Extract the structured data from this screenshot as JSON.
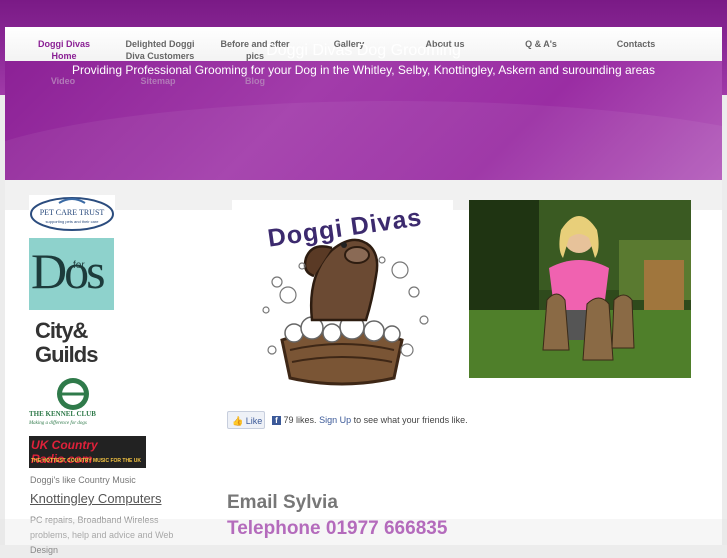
{
  "nav": {
    "items": [
      {
        "label_line1": "Doggi Divas",
        "label_line2": "Home",
        "active": true
      },
      {
        "label_line1": "Delighted Doggi",
        "label_line2": "Diva Customers",
        "active": false
      },
      {
        "label_line1": "Before and after",
        "label_line2": "pics",
        "active": false
      },
      {
        "label_line1": "Gallery",
        "label_line2": "",
        "active": false
      },
      {
        "label_line1": "About us",
        "label_line2": "",
        "active": false
      },
      {
        "label_line1": "Q & A's",
        "label_line2": "",
        "active": false
      },
      {
        "label_line1": "Contacts",
        "label_line2": "",
        "active": false
      },
      {
        "label_line1": "Video",
        "label_line2": "",
        "active": false
      },
      {
        "label_line1": "Sitemap",
        "label_line2": "",
        "active": false
      },
      {
        "label_line1": "Blog",
        "label_line2": "",
        "active": false
      }
    ]
  },
  "hero": {
    "title": "Doggi Divas Dog Grooming",
    "subtitle": "Providing Professional Grooming for your Dog in the Whitley, Selby, Knottingley, Askern and surounding areas"
  },
  "sidebar": {
    "petcare": {
      "name": "PET CARE TRUST",
      "tagline": "supporting pets and their care"
    },
    "dogsfor": {
      "main": "Dos",
      "small": "for"
    },
    "cityguilds": {
      "line1": "City&",
      "line2": "Guilds"
    },
    "kennel": {
      "name": "THE KENNEL CLUB",
      "tagline": "Making a difference for dogs"
    },
    "radio": {
      "name": "UK Country Radio.com",
      "tagline": "THE HOTTEST COUNTRY MUSIC FOR THE UK"
    },
    "caption": "Doggi's like Country Music",
    "link": "Knottingley Computers",
    "description": "PC repairs, Broadband Wireless problems, help and advice and Web Design"
  },
  "logo": {
    "text": "Doggi Divas"
  },
  "facebook": {
    "like_label": "Like",
    "count_text": "79 likes.",
    "signup_label": "Sign Up",
    "rest_text": "to see what your friends like."
  },
  "contact": {
    "email_label": "Email Sylvia",
    "phone_label": "Telephone 01977 666835"
  },
  "colors": {
    "brand": "#8a1f94",
    "accent": "#9a2aa6",
    "hero": "#9b2ea4"
  }
}
